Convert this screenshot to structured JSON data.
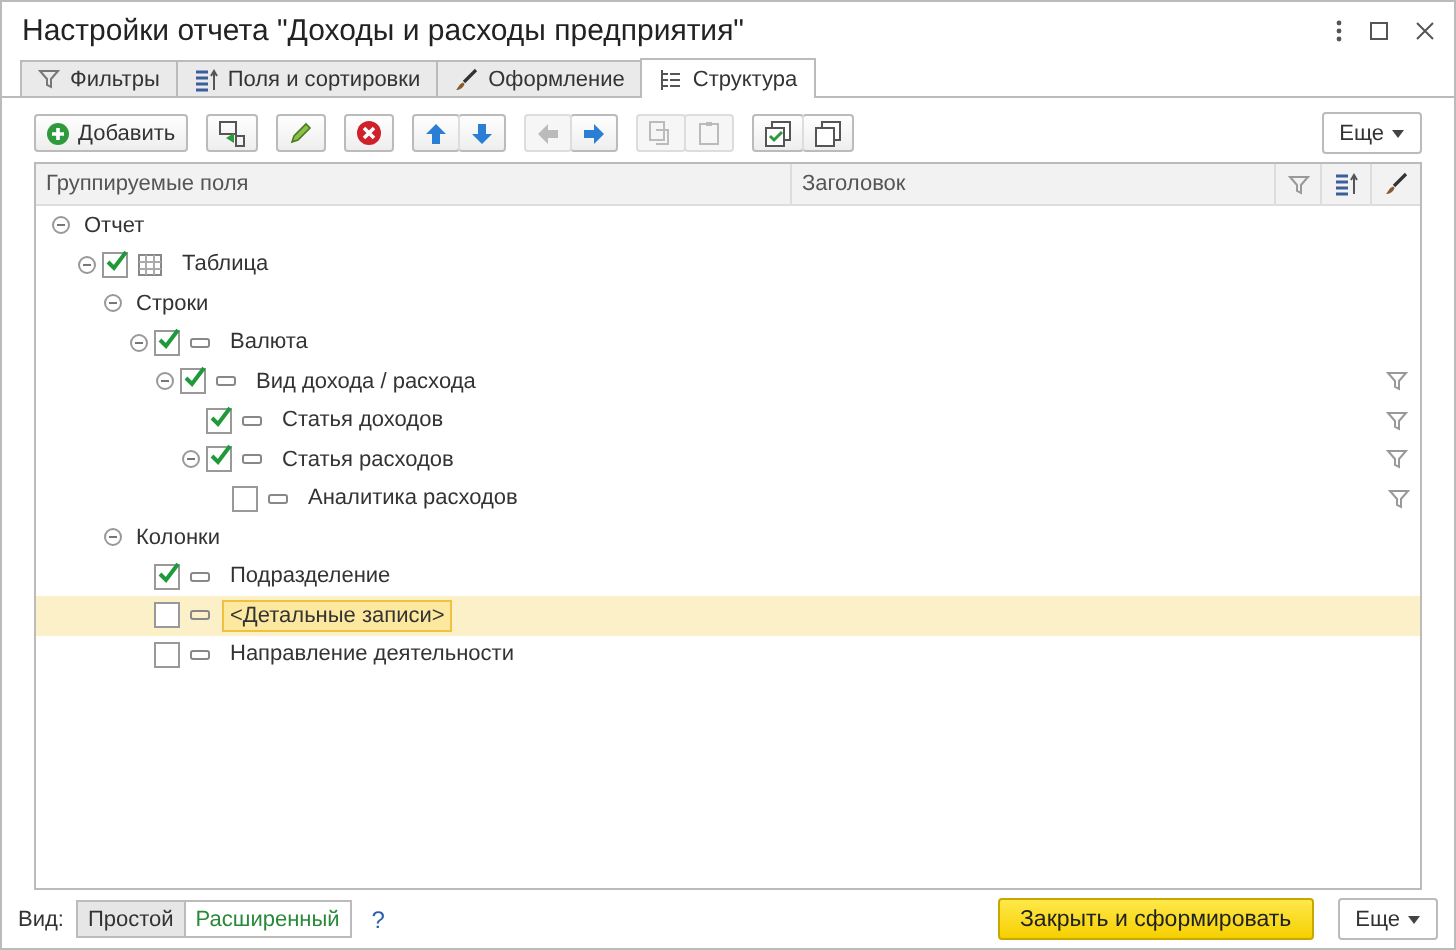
{
  "window": {
    "title": "Настройки отчета \"Доходы и расходы предприятия\""
  },
  "tabs": [
    {
      "kind": "filter",
      "label": "Фильтры",
      "selected": false
    },
    {
      "kind": "fields",
      "label": "Поля и сортировки",
      "selected": false
    },
    {
      "kind": "brush",
      "label": "Оформление",
      "selected": false
    },
    {
      "kind": "structure",
      "label": "Структура",
      "selected": true
    }
  ],
  "toolbar": {
    "groups": [
      {
        "buttons": [
          {
            "kind": "add",
            "label": "Добавить",
            "disabled": false
          }
        ]
      },
      {
        "buttons": [
          {
            "kind": "group",
            "disabled": false
          }
        ]
      },
      {
        "buttons": [
          {
            "kind": "edit",
            "disabled": false
          }
        ]
      },
      {
        "buttons": [
          {
            "kind": "delete",
            "disabled": false
          }
        ]
      },
      {
        "buttons": [
          {
            "kind": "up",
            "disabled": false
          },
          {
            "kind": "down",
            "disabled": false
          }
        ]
      },
      {
        "buttons": [
          {
            "kind": "left",
            "disabled": true
          },
          {
            "kind": "right",
            "disabled": false
          }
        ]
      },
      {
        "buttons": [
          {
            "kind": "copy",
            "disabled": true
          },
          {
            "kind": "paste",
            "disabled": true
          }
        ]
      },
      {
        "buttons": [
          {
            "kind": "check-all",
            "disabled": false
          },
          {
            "kind": "uncheck-all",
            "disabled": false
          }
        ]
      }
    ],
    "more": "Еще"
  },
  "table": {
    "columns": [
      {
        "kind": "text",
        "label": "Группируемые поля"
      },
      {
        "kind": "text",
        "label": "Заголовок"
      },
      {
        "kind": "filter"
      },
      {
        "kind": "sort"
      },
      {
        "kind": "brush"
      }
    ],
    "tree": [
      {
        "kind": "section",
        "label": "Отчет",
        "selected": false,
        "filter": false,
        "expanded": true,
        "children": [
          {
            "kind": "table",
            "label": "Таблица",
            "checked": true,
            "selected": false,
            "filter": false,
            "expanded": true,
            "children": [
              {
                "kind": "section",
                "label": "Строки",
                "selected": false,
                "filter": false,
                "expanded": true,
                "children": [
                  {
                    "kind": "field",
                    "label": "Валюта",
                    "checked": true,
                    "selected": false,
                    "filter": false,
                    "expanded": true,
                    "children": [
                      {
                        "kind": "field",
                        "label": "Вид дохода / расхода",
                        "checked": true,
                        "selected": false,
                        "filter": true,
                        "expanded": true,
                        "children": [
                          {
                            "kind": "field",
                            "label": "Статья доходов",
                            "checked": true,
                            "selected": false,
                            "filter": true
                          },
                          {
                            "kind": "field",
                            "label": "Статья расходов",
                            "checked": true,
                            "selected": false,
                            "filter": true,
                            "expanded": true,
                            "children": [
                              {
                                "kind": "field",
                                "label": "Аналитика расходов",
                                "checked": false,
                                "selected": false,
                                "filter": true
                              }
                            ]
                          }
                        ]
                      }
                    ]
                  }
                ]
              },
              {
                "kind": "section",
                "label": "Колонки",
                "selected": false,
                "filter": false,
                "expanded": true,
                "children": [
                  {
                    "kind": "field",
                    "label": "Подразделение",
                    "checked": true,
                    "selected": false,
                    "filter": false
                  },
                  {
                    "kind": "field",
                    "label": "<Детальные записи>",
                    "checked": false,
                    "selected": true,
                    "filter": false
                  },
                  {
                    "kind": "field",
                    "label": "Направление деятельности",
                    "checked": false,
                    "selected": false,
                    "filter": false
                  }
                ]
              }
            ]
          }
        ]
      }
    ]
  },
  "footer": {
    "view_label": "Вид:",
    "view_options": [
      {
        "label": "Простой",
        "selected": true
      },
      {
        "label": "Расширенный",
        "selected": false
      }
    ],
    "help": "?",
    "primary": "Закрыть и сформировать",
    "more": "Еще"
  }
}
